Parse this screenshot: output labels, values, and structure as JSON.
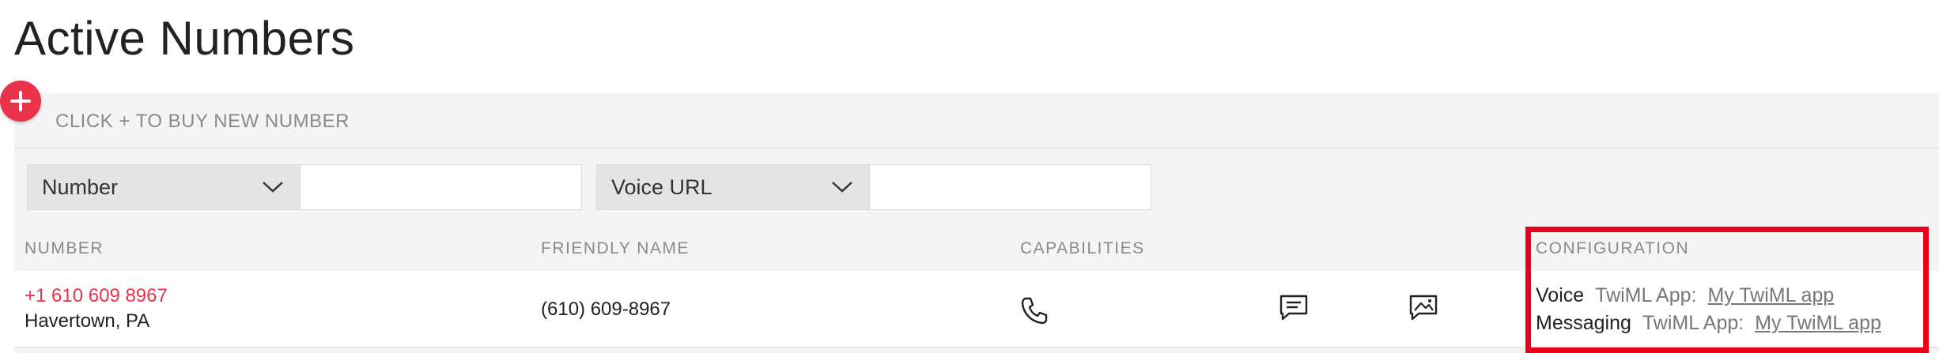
{
  "page": {
    "title": "Active Numbers"
  },
  "buy_bar": {
    "label": "CLICK + TO BUY NEW NUMBER",
    "add_symbol": "+"
  },
  "filters": [
    {
      "field": "Number",
      "value": ""
    },
    {
      "field": "Voice URL",
      "value": ""
    }
  ],
  "columns": {
    "number": "NUMBER",
    "friendly_name": "FRIENDLY NAME",
    "capabilities": "CAPABILITIES",
    "configuration": "CONFIGURATION"
  },
  "rows": [
    {
      "number": "+1 610 609 8967",
      "location": "Havertown, PA",
      "friendly_name": "(610) 609-8967",
      "capabilities": [
        "phone-icon",
        "sms-icon",
        "mms-icon"
      ],
      "configuration": [
        {
          "kind": "Voice",
          "app_label": "TwiML App:",
          "app_link": "My TwiML app"
        },
        {
          "kind": "Messaging",
          "app_label": "TwiML App:",
          "app_link": "My TwiML app"
        }
      ]
    }
  ],
  "colors": {
    "accent": "#e8334a",
    "highlight": "#e8001c"
  }
}
